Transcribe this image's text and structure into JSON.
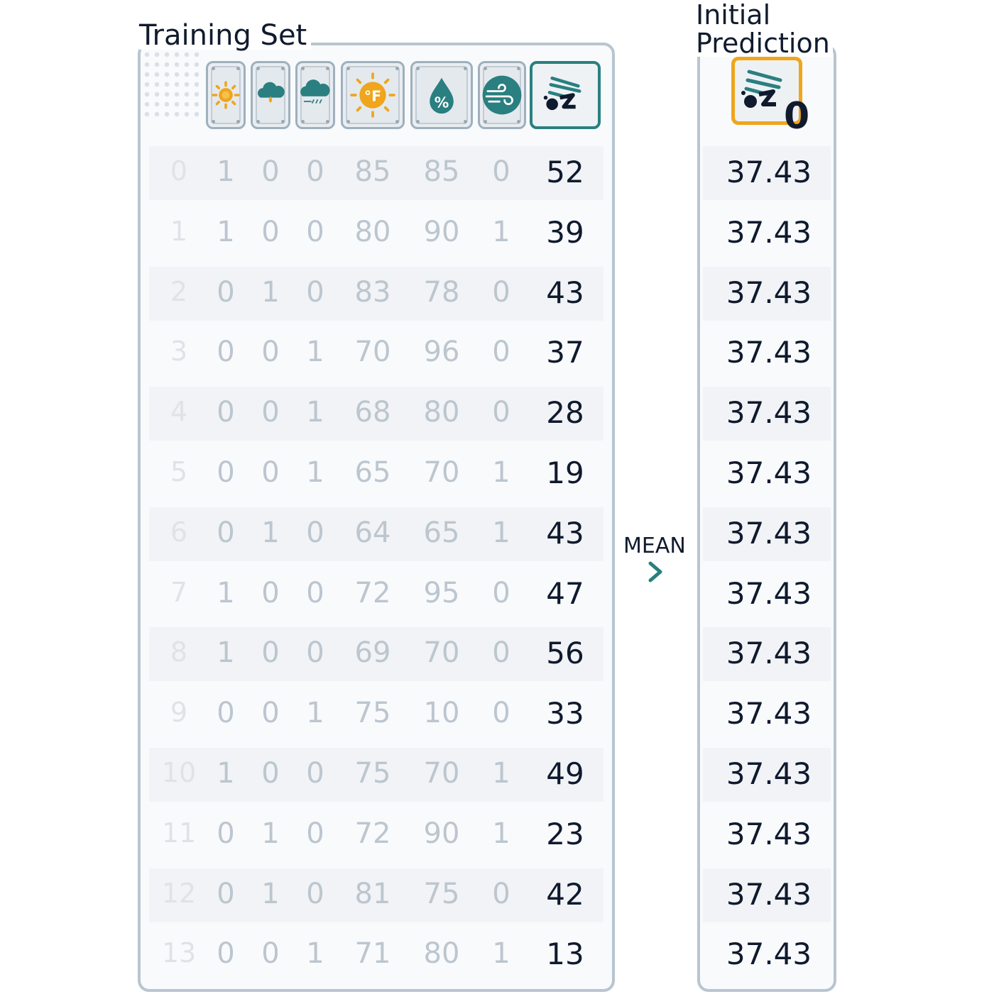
{
  "training_set": {
    "title": "Training Set",
    "columns": [
      {
        "icon": "sun-icon",
        "kind": "feature"
      },
      {
        "icon": "rain-cloud-icon",
        "kind": "feature"
      },
      {
        "icon": "overcast-cloud-icon",
        "kind": "feature"
      },
      {
        "icon": "temperature-fahrenheit-icon",
        "kind": "feature"
      },
      {
        "icon": "humidity-percent-icon",
        "kind": "feature"
      },
      {
        "icon": "wind-icon",
        "kind": "feature"
      },
      {
        "icon": "golfer-icon",
        "kind": "target"
      }
    ],
    "rows": [
      {
        "idx": "0",
        "sunny": "1",
        "rainy": "0",
        "overcast": "0",
        "temp": "85",
        "humidity": "85",
        "wind": "0",
        "target": "52"
      },
      {
        "idx": "1",
        "sunny": "1",
        "rainy": "0",
        "overcast": "0",
        "temp": "80",
        "humidity": "90",
        "wind": "1",
        "target": "39"
      },
      {
        "idx": "2",
        "sunny": "0",
        "rainy": "1",
        "overcast": "0",
        "temp": "83",
        "humidity": "78",
        "wind": "0",
        "target": "43"
      },
      {
        "idx": "3",
        "sunny": "0",
        "rainy": "0",
        "overcast": "1",
        "temp": "70",
        "humidity": "96",
        "wind": "0",
        "target": "37"
      },
      {
        "idx": "4",
        "sunny": "0",
        "rainy": "0",
        "overcast": "1",
        "temp": "68",
        "humidity": "80",
        "wind": "0",
        "target": "28"
      },
      {
        "idx": "5",
        "sunny": "0",
        "rainy": "0",
        "overcast": "1",
        "temp": "65",
        "humidity": "70",
        "wind": "1",
        "target": "19"
      },
      {
        "idx": "6",
        "sunny": "0",
        "rainy": "1",
        "overcast": "0",
        "temp": "64",
        "humidity": "65",
        "wind": "1",
        "target": "43"
      },
      {
        "idx": "7",
        "sunny": "1",
        "rainy": "0",
        "overcast": "0",
        "temp": "72",
        "humidity": "95",
        "wind": "0",
        "target": "47"
      },
      {
        "idx": "8",
        "sunny": "1",
        "rainy": "0",
        "overcast": "0",
        "temp": "69",
        "humidity": "70",
        "wind": "0",
        "target": "56"
      },
      {
        "idx": "9",
        "sunny": "0",
        "rainy": "0",
        "overcast": "1",
        "temp": "75",
        "humidity": "10",
        "wind": "0",
        "target": "33"
      },
      {
        "idx": "10",
        "sunny": "1",
        "rainy": "0",
        "overcast": "0",
        "temp": "75",
        "humidity": "70",
        "wind": "1",
        "target": "49"
      },
      {
        "idx": "11",
        "sunny": "0",
        "rainy": "1",
        "overcast": "0",
        "temp": "72",
        "humidity": "90",
        "wind": "1",
        "target": "23"
      },
      {
        "idx": "12",
        "sunny": "0",
        "rainy": "1",
        "overcast": "0",
        "temp": "81",
        "humidity": "75",
        "wind": "0",
        "target": "42"
      },
      {
        "idx": "13",
        "sunny": "0",
        "rainy": "0",
        "overcast": "1",
        "temp": "71",
        "humidity": "80",
        "wind": "1",
        "target": "13"
      }
    ]
  },
  "operation": {
    "label": "MEAN",
    "arrow_icon": "chevron-right-icon"
  },
  "initial_prediction": {
    "title_line1": "Initial",
    "title_line2": "Prediction",
    "icon": "golfer-icon",
    "subscript": "0",
    "values": [
      "37.43",
      "37.43",
      "37.43",
      "37.43",
      "37.43",
      "37.43",
      "37.43",
      "37.43",
      "37.43",
      "37.43",
      "37.43",
      "37.43",
      "37.43",
      "37.43"
    ]
  },
  "colors": {
    "accent_teal": "#2a7f80",
    "accent_orange": "#efa51c",
    "panel_border": "#b9c5cf",
    "dark_text": "#0f1a2e",
    "faded_text": "#bcc6cf"
  }
}
